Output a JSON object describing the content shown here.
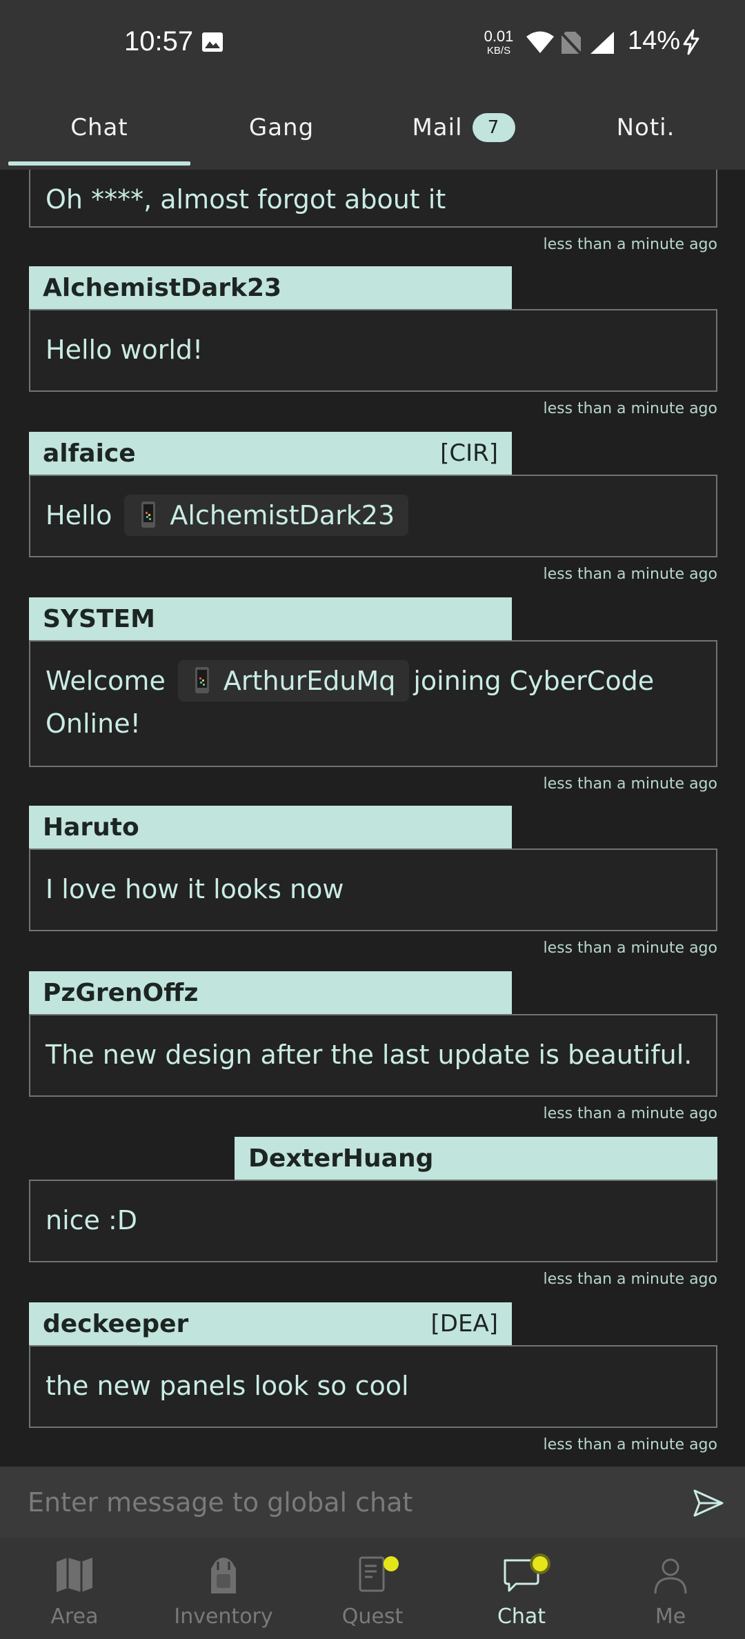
{
  "status_bar": {
    "time": "10:57",
    "speed_value": "0.01",
    "speed_unit": "KB/S",
    "battery": "14%",
    "icons": [
      "image-icon",
      "wifi-icon",
      "no-sim-icon",
      "signal-icon",
      "charging-icon"
    ]
  },
  "tabs": [
    {
      "label": "Chat",
      "active": true
    },
    {
      "label": "Gang",
      "active": false
    },
    {
      "label": "Mail",
      "badge": "7",
      "active": false
    },
    {
      "label": "Noti.",
      "active": false
    }
  ],
  "messages": [
    {
      "user": "",
      "tag": "",
      "text": "Oh ****, almost forgot about it",
      "time": "less than a minute ago"
    },
    {
      "user": "AlchemistDark23",
      "tag": "",
      "text": "Hello world!",
      "time": "less than a minute ago"
    },
    {
      "user": "alfaice",
      "tag": "[CIR]",
      "text_before": "Hello",
      "mention": "AlchemistDark23",
      "time": "less than a minute ago"
    },
    {
      "user": "SYSTEM",
      "tag": "",
      "text_before": "Welcome",
      "mention": "ArthurEduMq",
      "text_after": "joining CyberCode",
      "text_line2": "Online!",
      "time": "less than a minute ago"
    },
    {
      "user": "Haruto",
      "tag": "",
      "text": "I love how it looks now",
      "time": "less than a minute ago"
    },
    {
      "user": "PzGrenOffz",
      "tag": "",
      "text": "The new design after the last update is beautiful.",
      "time": "less than a minute ago"
    },
    {
      "user": "DexterHuang",
      "tag": "",
      "text": "nice :D",
      "time": "less than a minute ago",
      "own": true
    },
    {
      "user": "deckeeper",
      "tag": "[DEA]",
      "text": "the new panels look so cool",
      "time": "less than a minute ago"
    }
  ],
  "input": {
    "placeholder": "Enter message to global chat"
  },
  "bottom_nav": [
    {
      "label": "Area",
      "icon": "map-icon",
      "active": false
    },
    {
      "label": "Inventory",
      "icon": "backpack-icon",
      "active": false
    },
    {
      "label": "Quest",
      "icon": "quest-book-icon",
      "active": false,
      "notification": true
    },
    {
      "label": "Chat",
      "icon": "chat-bubble-icon",
      "active": true,
      "notification": true
    },
    {
      "label": "Me",
      "icon": "person-icon",
      "active": false
    }
  ],
  "colors": {
    "accent": "#c1e4dd",
    "background": "#1f1f1f",
    "bar": "#343434",
    "notification_dot": "#e4e51a"
  }
}
